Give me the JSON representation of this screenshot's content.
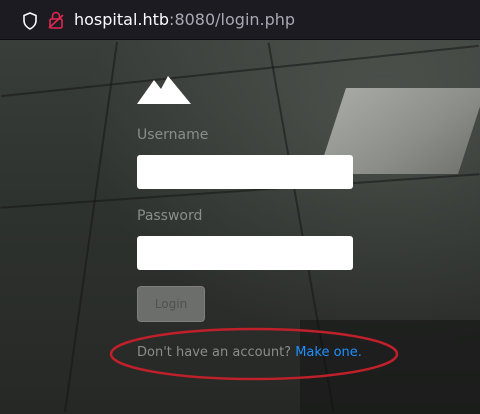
{
  "browser": {
    "url_host": "hospital.htb",
    "url_rest": ":8080/login.php",
    "icons": [
      "shield-icon",
      "lock-icon"
    ]
  },
  "login": {
    "logo_icon": "mountain-logo",
    "username_label": "Username",
    "username_value": "",
    "password_label": "Password",
    "password_value": "",
    "login_button": "Login",
    "signup_prompt": "Don't have an account?",
    "signup_link": "Make one."
  },
  "annotation": {
    "highlight_color": "#c0202a"
  },
  "colors": {
    "link": "#1e90ff",
    "urlbar_bg": "#1c1b22"
  }
}
